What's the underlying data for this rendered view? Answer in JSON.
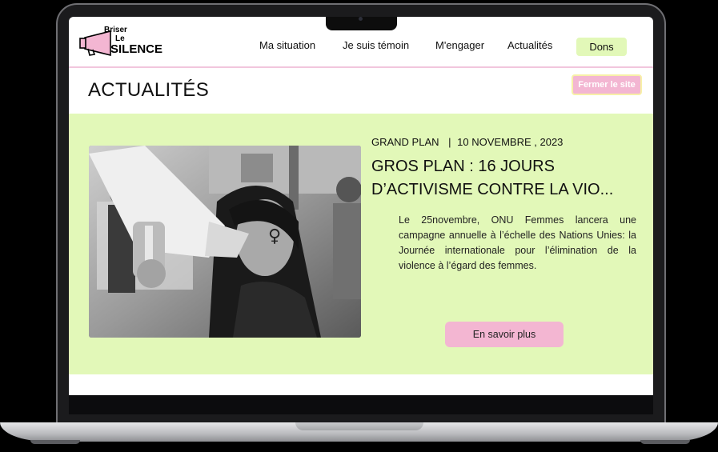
{
  "header": {
    "logo": {
      "line1": "Briser",
      "line2": "Le",
      "line3": "SILENCE"
    },
    "nav": [
      "Ma situation",
      "Je suis témoin",
      "M'engager",
      "Actualités"
    ],
    "donate_label": "Dons"
  },
  "page": {
    "title": "ACTUALITÉS",
    "close_site_label": "Fermer le site"
  },
  "article": {
    "category": "GRAND PLAN",
    "separator": "|",
    "date": "10 NOVEMBRE , 2023",
    "headline_line1": "GROS PLAN : 16 JOURS",
    "headline_line2": "D’ACTIVISME CONTRE LA VIO...",
    "excerpt": "Le 25novembre, ONU Femmes lancera une campagne annuelle à l’échelle des Nations Unies: la Journée internationale pour l’élimination de la violence à l’égard des femmes.",
    "cta_label": "En savoir plus",
    "image_icon": "woman-megaphone-photo"
  },
  "colors": {
    "accent_green": "#e2f8b8",
    "accent_pink": "#f3b6d2",
    "border_yellow": "#f7f0a8"
  }
}
